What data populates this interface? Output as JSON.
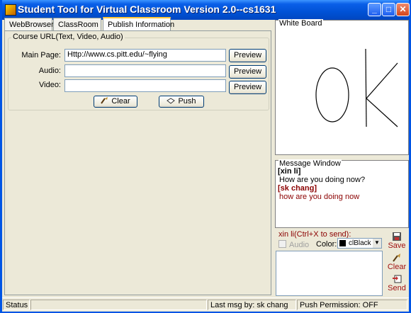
{
  "window": {
    "title": "Student Tool for Virtual Classroom Version 2.0--cs1631"
  },
  "tabs": [
    {
      "label": "WebBrowser"
    },
    {
      "label": "ClassRoom"
    },
    {
      "label": "Publish Information",
      "active": true
    }
  ],
  "course_url": {
    "legend": "Course URL(Text, Video, Audio)",
    "main_page": {
      "label": "Main Page:",
      "value": "Http://www.cs.pitt.edu/~flying"
    },
    "audio": {
      "label": "Audio:",
      "value": ""
    },
    "video": {
      "label": "Video:",
      "value": ""
    },
    "preview_label": "Preview",
    "clear_label": "Clear",
    "push_label": "Push"
  },
  "whiteboard": {
    "label": "White Board",
    "drawing_text": "OK"
  },
  "message_window": {
    "label": "Message Window",
    "messages": [
      {
        "sender": "[xin li]",
        "text": "How are you doing now?",
        "sender_color": "#000000",
        "text_color": "#000000"
      },
      {
        "sender": "[sk chang]",
        "text": "how are you doing now",
        "sender_color": "#8b0000",
        "text_color": "#8b0000"
      }
    ]
  },
  "compose": {
    "prompt": "xin li(Ctrl+X to send):",
    "audio_label": "Audio",
    "color_label": "Color:",
    "color_value": "clBlack",
    "save_label": "Save",
    "clear_label": "Clear",
    "send_label": "Send"
  },
  "statusbar": {
    "status": "Status",
    "last_msg": "Last msg by: sk chang",
    "push_permission": "Push Permission: OFF"
  },
  "colors": {
    "title_bar": "#0052d6",
    "window_bg": "#ece9d8",
    "sender_other": "#8b0000",
    "compose_prompt": "#8b0000"
  }
}
